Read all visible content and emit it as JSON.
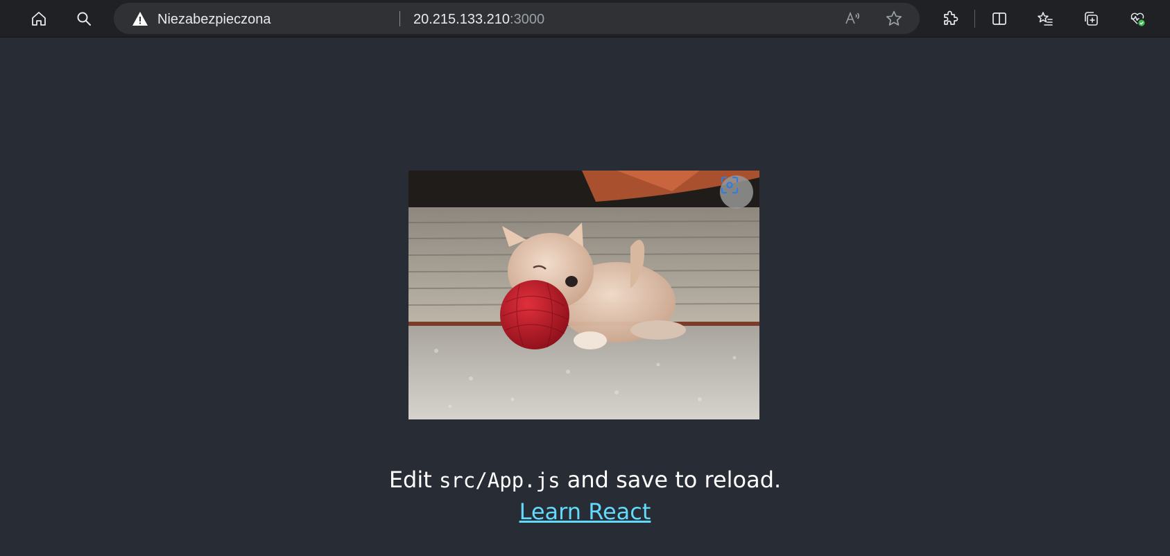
{
  "browser": {
    "security_label": "Niezabezpieczona",
    "url_host": "20.215.133.210",
    "url_port": ":3000",
    "icons": {
      "home": "home-icon",
      "search": "search-icon",
      "warning": "warning-icon",
      "read_aloud": "read-aloud-icon",
      "favorite": "favorite-star-icon",
      "extensions": "extensions-puzzle-icon",
      "split_screen": "split-screen-icon",
      "favorites": "favorites-list-icon",
      "collections": "collections-icon",
      "health": "browser-essentials-icon"
    },
    "colors": {
      "toolbar_bg": "#202124",
      "address_bg": "#303134",
      "health_badge": "#3fb950"
    }
  },
  "app": {
    "background": "#282c34",
    "edit_prefix": "Edit ",
    "edit_code": "src/App.js",
    "edit_suffix": " and save to reload.",
    "link_label": "Learn React",
    "link_color": "#61dafb",
    "image_overlay_icon": "visual-search-icon"
  }
}
